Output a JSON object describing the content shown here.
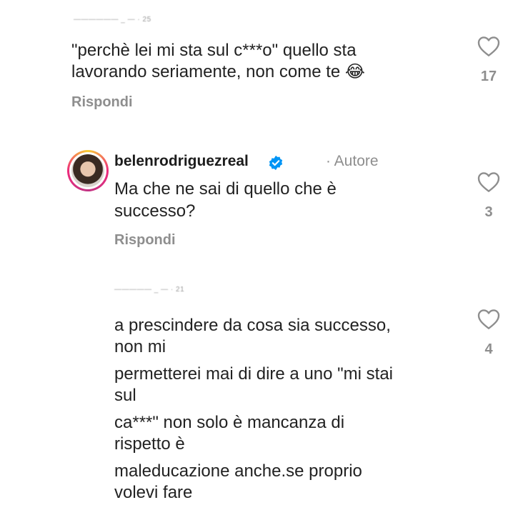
{
  "comments": [
    {
      "username_blurred": "—————— _ — · 25",
      "lines": [
        "\"perchè lei mi sta sul c***o\" quello sta",
        "lavorando seriamente, non come te 😂"
      ],
      "reply": "Rispondi",
      "likes": "17"
    },
    {
      "username": "belenrodriguezreal",
      "author_tag": "· Autore",
      "lines": [
        "Ma che ne sai di quello che è",
        "successo?"
      ],
      "reply": "Rispondi",
      "likes": "3"
    },
    {
      "username_blurred": "————— _ — · 21",
      "paragraphs": [
        [
          "a prescindere da cosa sia successo,",
          "non mi"
        ],
        [
          "permetterei mai di dire a uno \"mi stai",
          "sul"
        ],
        [
          "ca***\" non solo è mancanza di",
          "rispetto è"
        ],
        [
          "maleducazione anche.se proprio",
          "volevi fare"
        ]
      ],
      "likes": "4"
    }
  ],
  "colors": {
    "text": "#222222",
    "muted": "#8e8e8e",
    "verified": "#0095f6"
  },
  "icons": {
    "like": "heart-outline-icon",
    "verified": "verified-badge-icon"
  }
}
